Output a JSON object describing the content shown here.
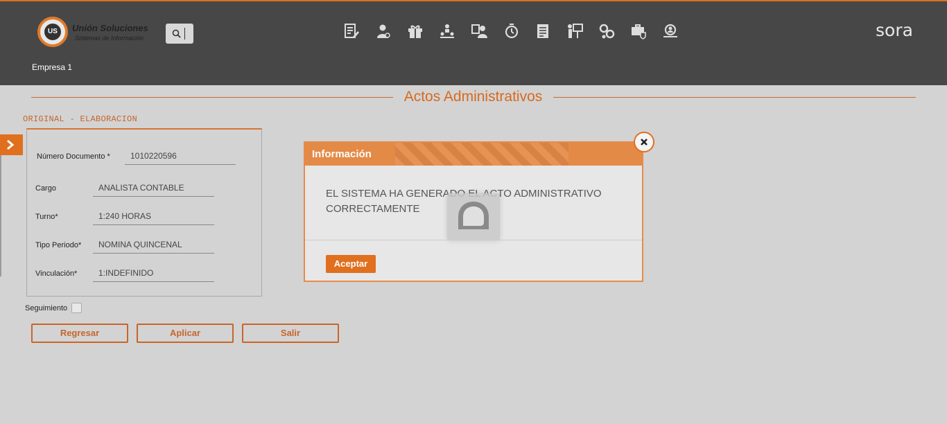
{
  "header": {
    "logo_title": "Unión Soluciones",
    "logo_subtitle": "Sistemas de Información",
    "logo_mark": "US",
    "company": "Empresa 1",
    "brand": "sora",
    "accent": "#e0701e",
    "nav_icons": [
      "document-edit-icon",
      "user-icon",
      "gift-icon",
      "org-chart-icon",
      "team-icon",
      "timer-icon",
      "report-icon",
      "presentation-icon",
      "settings-icon",
      "medical-kit-icon",
      "search-user-icon"
    ]
  },
  "page": {
    "title": "Actos Administrativos",
    "section": "ORIGINAL - ELABORACION"
  },
  "form": {
    "numero_label": "Número Documento",
    "numero_required": "*",
    "numero_value": "1010220596",
    "cargo_label": "Cargo",
    "cargo_value": "ANALISTA CONTABLE",
    "turno_label": "Turno*",
    "turno_value": "1:240 HORAS",
    "tipo_label": "Tipo Periodo*",
    "tipo_value": "NOMINA QUINCENAL",
    "vinc_label": "Vinculación*",
    "vinc_value": "1:INDEFINIDO",
    "seguimiento_label": "Seguimiento"
  },
  "buttons": {
    "regresar": "Regresar",
    "aplicar": "Aplicar",
    "salir": "Salir"
  },
  "modal": {
    "title": "Información",
    "message": "EL SISTEMA HA GENERADO EL ACTO ADMINISTRATIVO CORRECTAMENTE",
    "accept": "Aceptar"
  }
}
